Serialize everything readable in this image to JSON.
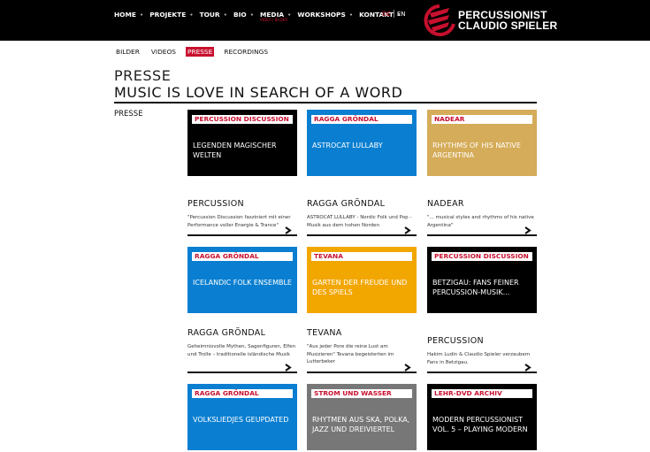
{
  "header": {
    "nav": [
      {
        "label": "HOME",
        "sub": ""
      },
      {
        "label": "PROJEKTE",
        "sub": ""
      },
      {
        "label": "TOUR",
        "sub": ""
      },
      {
        "label": "BIO",
        "sub": ""
      },
      {
        "label": "MEDIA",
        "sub": "VIDEO | BILDER"
      },
      {
        "label": "WORKSHOPS",
        "sub": ""
      },
      {
        "label": "KONTAKT",
        "sub": ""
      }
    ],
    "lang": {
      "de": "DE",
      "en": "EN"
    },
    "logo": {
      "line1": "PERCUSSIONIST",
      "line2": "CLAUDIO SPIELER"
    },
    "colors": {
      "accent": "#c8102e",
      "bar": "#000000"
    }
  },
  "subnav": [
    "BILDER",
    "VIDEOS",
    "PRESSE",
    "RECORDINGS"
  ],
  "page": {
    "title": "PRESSE",
    "subtitle": "MUSIC IS LOVE IN SEARCH OF A WORD",
    "side_label": "PRESSE"
  },
  "rows": [
    {
      "tiles": [
        {
          "tag": "PERCUSSION DISCUSSION",
          "text": "LEGENDEN MAGISCHER WELTEN",
          "color": "black"
        },
        {
          "tag": "RAGGA GRÖNDAL",
          "text": "ASTROCAT LULLABY",
          "color": "blue"
        },
        {
          "tag": "NADEAR",
          "text": "RHYTHMS OF HIS NATIVE ARGENTINA",
          "color": "gold"
        }
      ],
      "teasers": [
        {
          "head": "PERCUSSION",
          "body": "\"Percussion Discussion fasziniert mit einer Performance voller Energie & Trance\""
        },
        {
          "head": "RAGGA GRÖNDAL",
          "body": "ASTROCAT LULLABY - Nordic Folk und Pop - Musik aus dem hohen Norden"
        },
        {
          "head": "NADEAR",
          "body": "\"... musical styles and rhythms of his native Argentina\""
        }
      ]
    },
    {
      "tiles": [
        {
          "tag": "RAGGA GRÖNDAL",
          "text": "ICELANDIC FOLK ENSEMBLE",
          "color": "blue"
        },
        {
          "tag": "TEVANA",
          "text": "GARTEN DER FREUDE UND DES SPIELS",
          "color": "orange"
        },
        {
          "tag": "PERCUSSION DISCUSSION",
          "text": "BETZIGAU: FANS FEINER PERCUSSION-MUSIK...",
          "color": "black"
        }
      ],
      "teasers": [
        {
          "head": "RAGGA GRÖNDAL",
          "body": "Geheimnisvolle Mythen, Sagenfiguren, Elfen und Trolle – traditionelle isländische Musik"
        },
        {
          "head": "TEVANA",
          "body": "\"Aus jeder Pore die reine Lust am Musizieren\" Tevana begeisterten im Lutterbeker"
        },
        {
          "head": "PERCUSSION",
          "body": "Hakim Ludin & Claudio Spieler verzaubern Fans in Betzigau."
        }
      ]
    },
    {
      "tiles": [
        {
          "tag": "RAGGA GRÖNDAL",
          "text": "VOLKSLIEDJES GEUPDATED",
          "color": "blue"
        },
        {
          "tag": "STROM UND WASSER",
          "text": "RHYTMEN AUS SKA, POLKA, JAZZ UND DREIVIERTEL",
          "color": "gray"
        },
        {
          "tag": "LEHR-DVD ARCHIV",
          "text": "MODERN PERCUSSIONIST VOL. 5 – PLAYING MODERN",
          "color": "black"
        }
      ]
    }
  ]
}
